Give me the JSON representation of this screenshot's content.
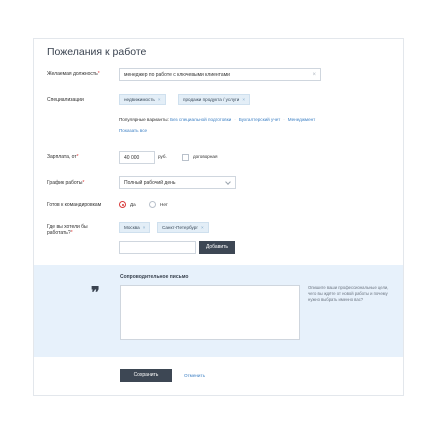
{
  "title": "Пожелания к работе",
  "position": {
    "label": "Желаемая должность",
    "required_mark": "*",
    "value": "менеджер по работе с ключевыми клиентами",
    "clear_icon": "×"
  },
  "specialization": {
    "label": "Специализации",
    "tags": [
      "недвижимость",
      "продажи продукта / услуги"
    ],
    "popular_label": "Популярные варианты:",
    "popular": [
      "Без специальной подготовки",
      "Бухгалтерский учет",
      "Менеджмент"
    ],
    "show_all": "Показать все"
  },
  "salary": {
    "label": "Зарплата, от",
    "required_mark": "*",
    "value": "40 000",
    "currency": "руб.",
    "negotiable_label": "договорная"
  },
  "schedule": {
    "label": "График работы",
    "required_mark": "*",
    "value": "Полный рабочий день"
  },
  "trips": {
    "label": "Готов к командировкам",
    "yes": "Да",
    "no": "Нет",
    "selected": "yes"
  },
  "location": {
    "label": "Где вы хотели бы работать?",
    "required_mark": "*",
    "tags": [
      "Москва",
      "Санкт-Петербург"
    ],
    "add_button": "Добавить"
  },
  "cover_letter": {
    "title": "Сопроводительное письмо",
    "quote_mark": "❞",
    "hint": "Опишите ваши профессиональные цели, чего вы ждёте от новой работы и почему нужно выбрать именно вас?"
  },
  "actions": {
    "save": "Сохранить",
    "cancel": "Отменить"
  },
  "colors": {
    "accent": "#3b7fc4",
    "required": "#e23b3b",
    "dark_button": "#3d4754",
    "band": "#e7f1fb",
    "tag_bg": "#e3eef7"
  }
}
